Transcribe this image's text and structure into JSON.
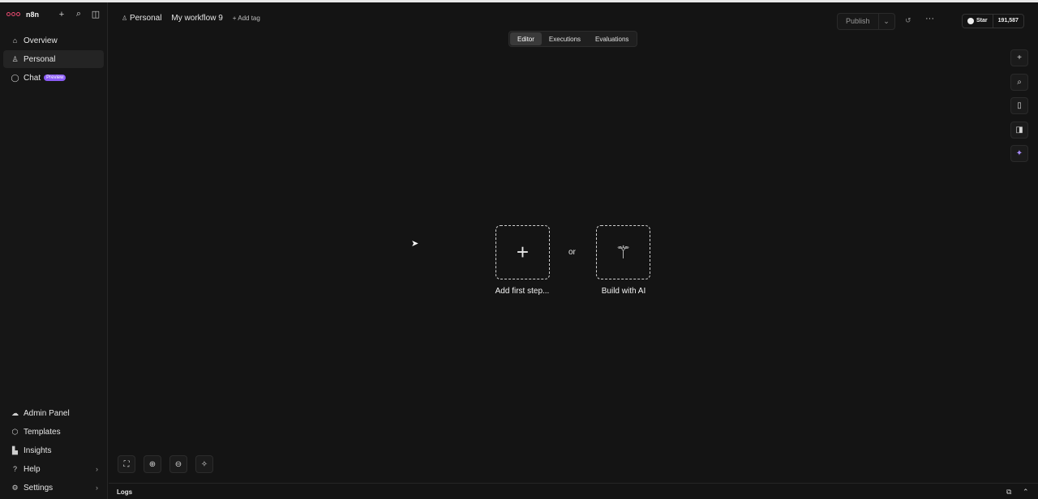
{
  "brand": {
    "name": "n8n",
    "accent": "#ea4b71"
  },
  "sidebar": {
    "tools": [
      "plus-icon",
      "search-icon",
      "panel-toggle-icon"
    ],
    "items": [
      {
        "label": "Overview",
        "icon": "home-icon"
      },
      {
        "label": "Personal",
        "icon": "user-icon",
        "active": true
      },
      {
        "label": "Chat",
        "icon": "chat-icon",
        "badge": "Preview"
      }
    ],
    "bottom": [
      {
        "label": "Admin Panel",
        "icon": "cloud-icon"
      },
      {
        "label": "Templates",
        "icon": "box-icon"
      },
      {
        "label": "Insights",
        "icon": "chart-icon"
      },
      {
        "label": "Help",
        "icon": "help-icon",
        "chevron": true
      },
      {
        "label": "Settings",
        "icon": "gear-icon",
        "chevron": true
      }
    ]
  },
  "header": {
    "project": "Personal",
    "workflow_name": "My workflow 9",
    "add_tag": "+ Add tag",
    "tabs": [
      {
        "label": "Editor",
        "active": true
      },
      {
        "label": "Executions"
      },
      {
        "label": "Evaluations"
      }
    ],
    "publish_label": "Publish",
    "github": {
      "star_label": "Star",
      "count": "191,587"
    }
  },
  "canvas": {
    "add_first_step": "Add first step...",
    "or_text": "or",
    "build_with_ai": "Build with AI"
  },
  "right_toolbar": [
    "plus-icon",
    "search-icon",
    "sticky-note-icon",
    "panel-icon",
    "ai-sparkle-icon"
  ],
  "zoom_controls": [
    "fit-view-icon",
    "zoom-in-icon",
    "zoom-out-icon",
    "tidy-up-icon"
  ],
  "logs": {
    "label": "Logs"
  }
}
